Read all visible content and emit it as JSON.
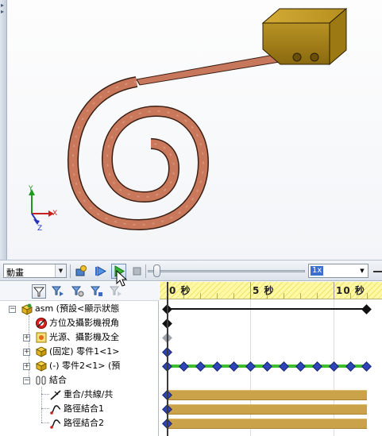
{
  "viewport": {
    "triad": {
      "x_label": "X",
      "y_label": "Y",
      "z_label": "Z"
    }
  },
  "toolbar": {
    "study_type": "動畫",
    "speed": "1x",
    "playback_position": 0
  },
  "tree": {
    "rows": [
      {
        "label": "asm (預設<顯示狀態",
        "icon": "assembly-icon"
      },
      {
        "label": "方位及攝影機視角",
        "icon": "orientation-camera-icon"
      },
      {
        "label": "光源、攝影機及全",
        "icon": "lights-cameras-icon"
      },
      {
        "label": "(固定) 零件1<1>",
        "icon": "part-icon"
      },
      {
        "label": "(-) 零件2<1> (預",
        "icon": "part-icon"
      },
      {
        "label": "結合",
        "icon": "mates-folder-icon"
      },
      {
        "label": "重合/共線/共",
        "icon": "coincident-mate-icon"
      },
      {
        "label": "路徑結合1",
        "icon": "path-mate-icon"
      },
      {
        "label": "路徑結合2",
        "icon": "path-mate-icon"
      }
    ]
  },
  "timeline": {
    "ticks": [
      {
        "label": "0 秒"
      },
      {
        "label": "5 秒"
      },
      {
        "label": "10 秒"
      }
    ]
  },
  "colors": {
    "strip": "#c5725a",
    "block": "#a8841a",
    "key_blue": "#2f44b8",
    "track_green": "#3fbf2e",
    "track_gold": "#c9a24a",
    "header_yellow": "#fff9a5"
  }
}
